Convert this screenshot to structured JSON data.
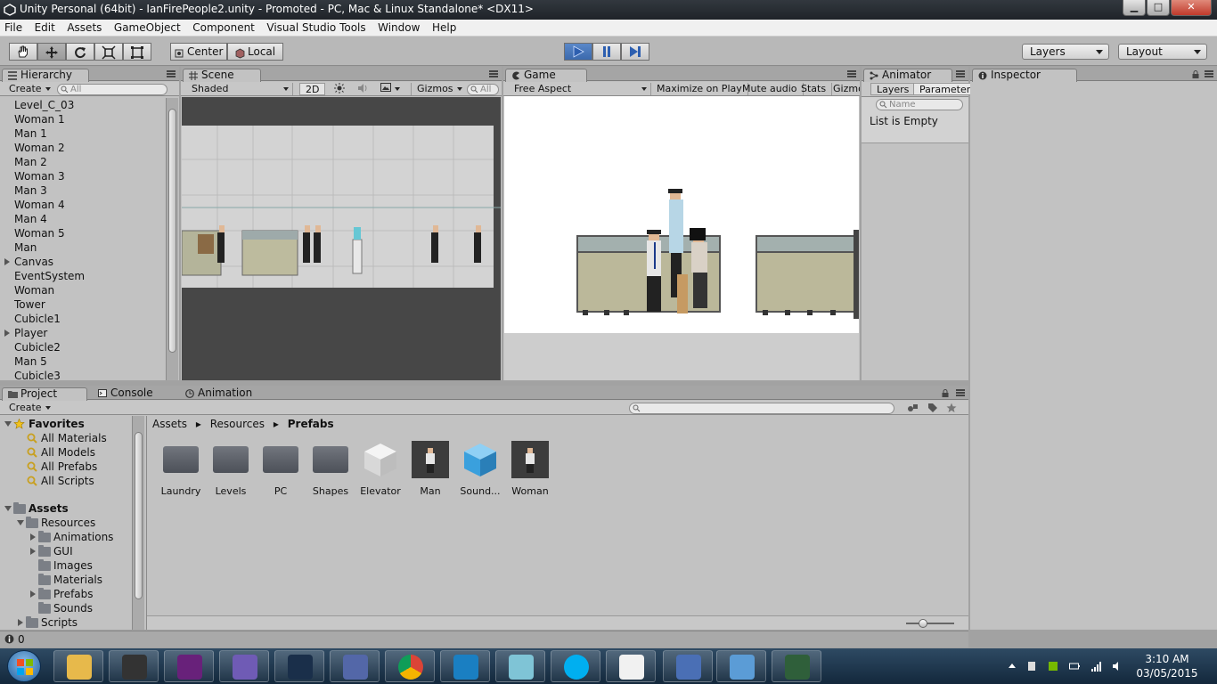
{
  "window": {
    "title": "Unity Personal (64bit) - IanFirePeople2.unity - Promoted - PC, Mac & Linux Standalone* <DX11>",
    "min": "▁",
    "max": "□",
    "close": "✕"
  },
  "menu": [
    "File",
    "Edit",
    "Assets",
    "GameObject",
    "Component",
    "Visual Studio Tools",
    "Window",
    "Help"
  ],
  "toolbar": {
    "pivot_center": "Center",
    "pivot_local": "Local",
    "layers": "Layers",
    "layout": "Layout"
  },
  "hierarchy": {
    "tab": "Hierarchy",
    "create": "Create",
    "search_placeholder": "All",
    "items": [
      {
        "label": "Level_C_03",
        "expandable": false
      },
      {
        "label": "Woman 1",
        "expandable": false
      },
      {
        "label": "Man 1",
        "expandable": false
      },
      {
        "label": "Woman 2",
        "expandable": false
      },
      {
        "label": "Man 2",
        "expandable": false
      },
      {
        "label": "Woman 3",
        "expandable": false
      },
      {
        "label": "Man 3",
        "expandable": false
      },
      {
        "label": "Woman 4",
        "expandable": false
      },
      {
        "label": "Man 4",
        "expandable": false
      },
      {
        "label": "Woman 5",
        "expandable": false
      },
      {
        "label": "Man",
        "expandable": false
      },
      {
        "label": "Canvas",
        "expandable": true
      },
      {
        "label": "EventSystem",
        "expandable": false
      },
      {
        "label": "Woman",
        "expandable": false
      },
      {
        "label": "Tower",
        "expandable": false
      },
      {
        "label": "Cubicle1",
        "expandable": false
      },
      {
        "label": "Player",
        "expandable": true
      },
      {
        "label": "Cubicle2",
        "expandable": false
      },
      {
        "label": "Man 5",
        "expandable": false
      },
      {
        "label": "Cubicle3",
        "expandable": false
      }
    ]
  },
  "scene": {
    "tab": "Scene",
    "shading": "Shaded",
    "mode_2d": "2D",
    "gizmos": "Gizmos",
    "search_placeholder": "All"
  },
  "game": {
    "tab": "Game",
    "aspect": "Free Aspect",
    "maximize": "Maximize on Play",
    "mute": "Mute audio",
    "stats": "Stats",
    "gizmos": "Gizmo"
  },
  "animator": {
    "tab": "Animator",
    "layers_tab": "Layers",
    "parameters_tab": "Parameters",
    "search_placeholder": "Name",
    "empty": "List is Empty"
  },
  "inspector": {
    "tab": "Inspector"
  },
  "bottom_tabs": {
    "project": "Project",
    "console": "Console",
    "animation": "Animation"
  },
  "project": {
    "create": "Create",
    "favorites": {
      "label": "Favorites",
      "items": [
        "All Materials",
        "All Models",
        "All Prefabs",
        "All Scripts"
      ]
    },
    "assets": {
      "label": "Assets",
      "resources": "Resources",
      "children": [
        {
          "label": "Animations",
          "expandable": true
        },
        {
          "label": "GUI",
          "expandable": true
        },
        {
          "label": "Images",
          "expandable": false
        },
        {
          "label": "Materials",
          "expandable": false
        },
        {
          "label": "Prefabs",
          "expandable": true
        },
        {
          "label": "Sounds",
          "expandable": false
        }
      ],
      "scripts": "Scripts"
    },
    "breadcrumb": [
      "Assets",
      "Resources",
      "Prefabs"
    ],
    "breadcrumb_sep": "▸",
    "items": [
      {
        "label": "Laundry",
        "kind": "folder"
      },
      {
        "label": "Levels",
        "kind": "folder"
      },
      {
        "label": "PC",
        "kind": "folder"
      },
      {
        "label": "Shapes",
        "kind": "folder"
      },
      {
        "label": "Elevator",
        "kind": "cube-white"
      },
      {
        "label": "Man",
        "kind": "sprite"
      },
      {
        "label": "Sound...",
        "kind": "cube-blue"
      },
      {
        "label": "Woman",
        "kind": "sprite"
      }
    ]
  },
  "status": {
    "count": "0"
  },
  "taskbar": {
    "time": "3:10 AM",
    "date": "03/05/2015",
    "apps": [
      "explorer-icon",
      "unity-icon",
      "visual-studio-icon",
      "github-icon",
      "webstorm-icon",
      "php-icon",
      "chrome-icon",
      "sourcetree-icon",
      "notepad-icon",
      "skype-icon",
      "wordpad-icon",
      "paint-icon",
      "photos-icon",
      "task-manager-icon"
    ]
  },
  "colors": {
    "accent_play": "#3b69ad",
    "panel_bg": "#c2c2c2",
    "scene_bg": "#474747",
    "taskbar": "#13283c"
  }
}
